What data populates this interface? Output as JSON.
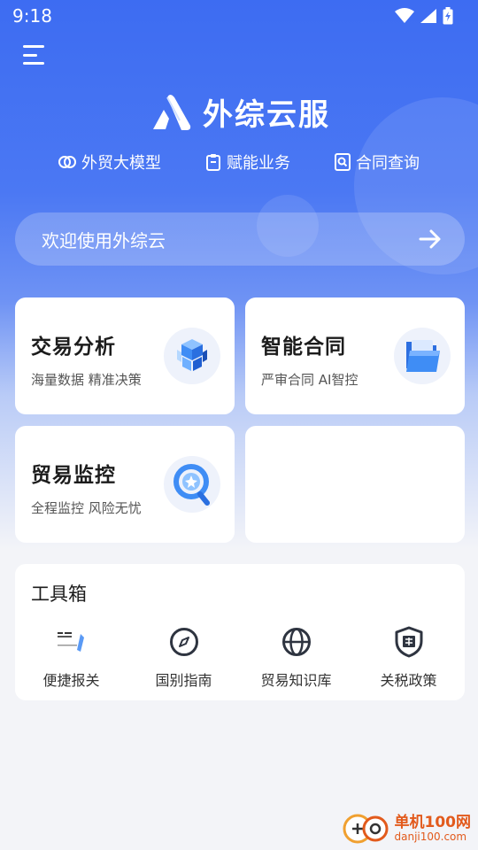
{
  "status_bar": {
    "time": "9:18"
  },
  "brand": {
    "name": "外综云服"
  },
  "quick_links": [
    {
      "label": "外贸大模型",
      "icon": "brain-icon"
    },
    {
      "label": "赋能业务",
      "icon": "clipboard-icon"
    },
    {
      "label": "合同查询",
      "icon": "doc-search-icon"
    }
  ],
  "search": {
    "text": "欢迎使用外综云"
  },
  "cards": [
    {
      "title": "交易分析",
      "subtitle": "海量数据 精准决策",
      "icon": "cubes-icon"
    },
    {
      "title": "智能合同",
      "subtitle": "严审合同 AI智控",
      "icon": "folder-icon"
    },
    {
      "title": "贸易监控",
      "subtitle": "全程监控 风险无忧",
      "icon": "monitor-ring-icon"
    }
  ],
  "toolbox": {
    "title": "工具箱",
    "items": [
      {
        "label": "便捷报关",
        "icon": "customs-icon"
      },
      {
        "label": "国别指南",
        "icon": "compass-icon"
      },
      {
        "label": "贸易知识库",
        "icon": "globe-icon"
      },
      {
        "label": "关税政策",
        "icon": "tax-shield-icon"
      }
    ]
  },
  "watermark": {
    "main": "单机100网",
    "sub": "danji100.com"
  },
  "colors": {
    "brand_blue": "#3d6cf2",
    "background": "#f3f4f8",
    "watermark_orange": "#e25a1c"
  }
}
